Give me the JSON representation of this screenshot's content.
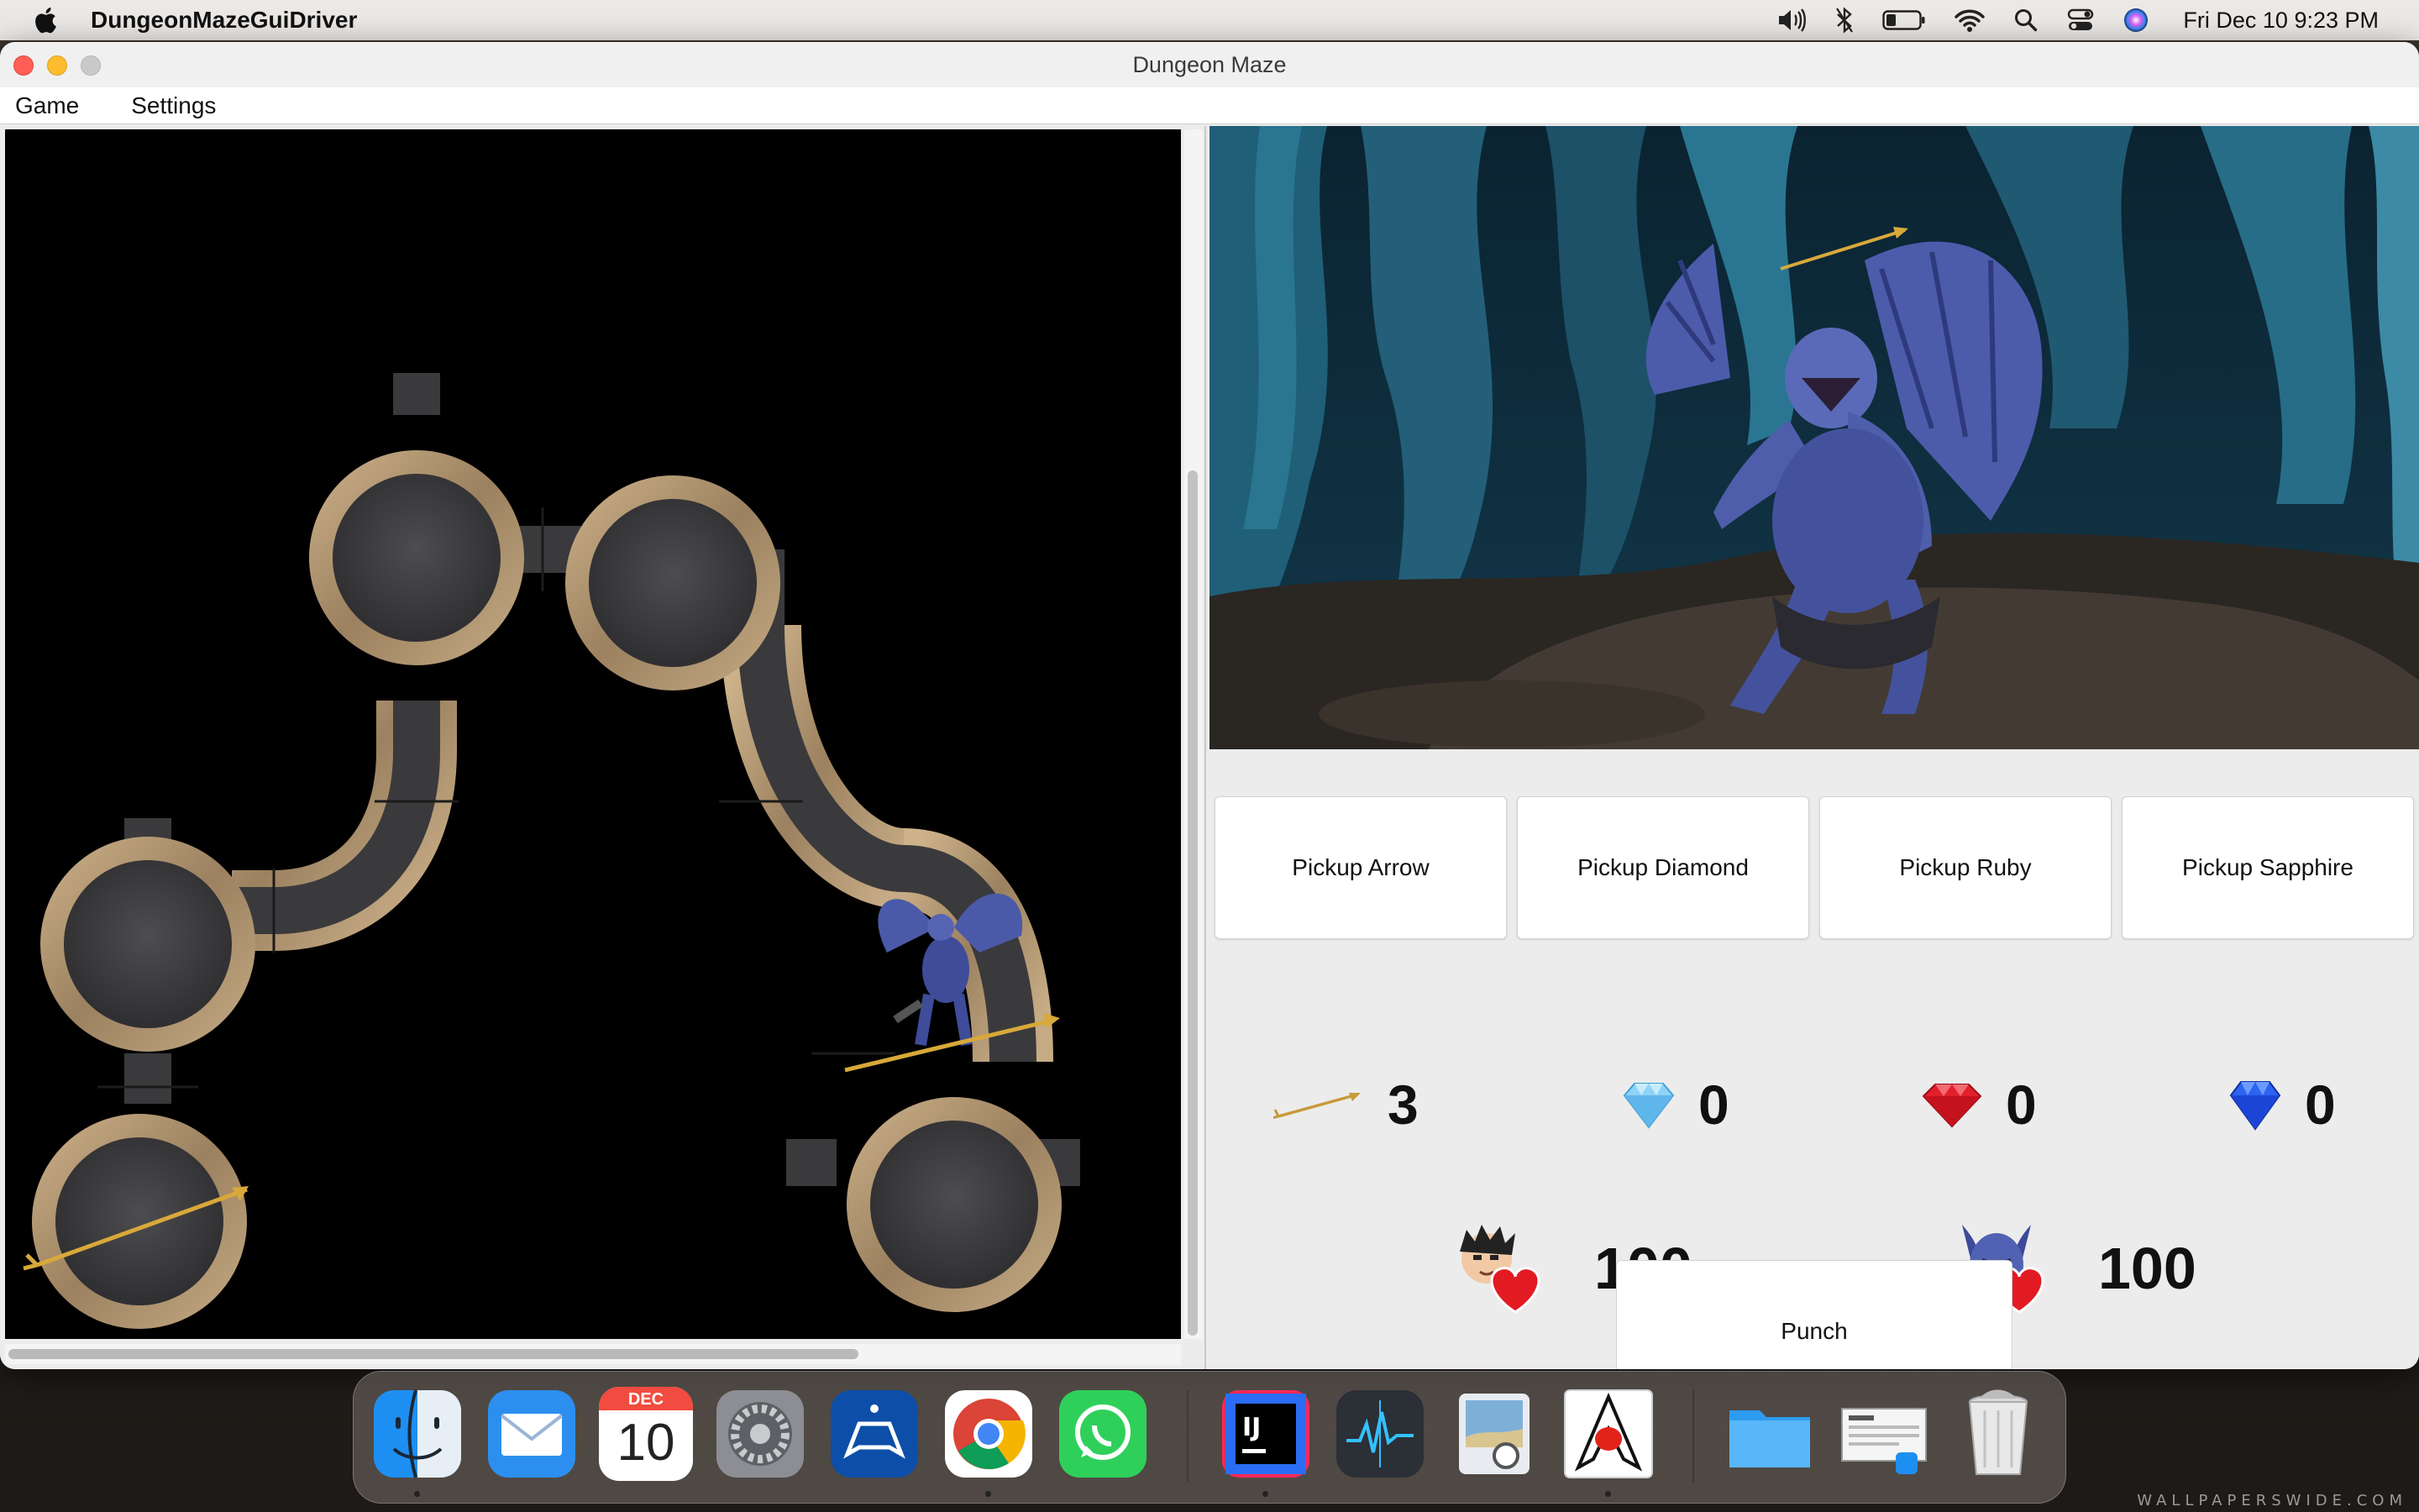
{
  "menubar": {
    "app_name": "DungeonMazeGuiDriver",
    "clock": "Fri Dec 10  9:23 PM",
    "status_icons": [
      "volume-icon",
      "bluetooth-icon",
      "battery-icon",
      "wifi-icon",
      "spotlight-search-icon",
      "control-center-icon",
      "siri-icon"
    ]
  },
  "window": {
    "title": "Dungeon Maze",
    "menus": [
      "Game",
      "Settings"
    ]
  },
  "maze": {
    "rooms": [
      {
        "name": "maze-room",
        "contents": ""
      },
      {
        "name": "maze-room",
        "contents": ""
      },
      {
        "name": "maze-room",
        "contents": ""
      },
      {
        "name": "maze-room",
        "contents": "arrow"
      },
      {
        "name": "maze-room",
        "contents": ""
      }
    ],
    "player_position": "gargoyle with arrow on path tile",
    "vscroll_thumb": 0.72,
    "hscroll_thumb": 0.72
  },
  "scene": {
    "monster": "gargoyle-monster",
    "item": "arrow"
  },
  "pickup_buttons": [
    {
      "label": "Pickup Arrow"
    },
    {
      "label": "Pickup Diamond"
    },
    {
      "label": "Pickup Ruby"
    },
    {
      "label": "Pickup Sapphire"
    }
  ],
  "inventory": {
    "arrow": "3",
    "diamond": "0",
    "ruby": "0",
    "sapphire": "0"
  },
  "health": {
    "player": "100",
    "monster": "100"
  },
  "actions": {
    "punch_label": "Punch"
  },
  "colors": {
    "diamond": "#7cc7f2",
    "ruby": "#e0202a",
    "sapphire": "#1f56e8",
    "heart": "#e21b23",
    "arrow": "#d8a93a",
    "cave": "#1a4a5e"
  },
  "dock": {
    "apps": [
      "finder-icon",
      "mail-icon",
      "calendar-icon",
      "system-preferences-icon",
      "playstation-app-icon",
      "chrome-icon",
      "whatsapp-icon",
      "intellij-icon",
      "activity-monitor-icon",
      "preview-icon",
      "java-app-icon",
      "folder-icon",
      "screenshot-stack-icon",
      "trash-icon"
    ],
    "calendar_month": "DEC",
    "calendar_day": "10"
  },
  "watermark": "WALLPAPERSWIDE.COM"
}
